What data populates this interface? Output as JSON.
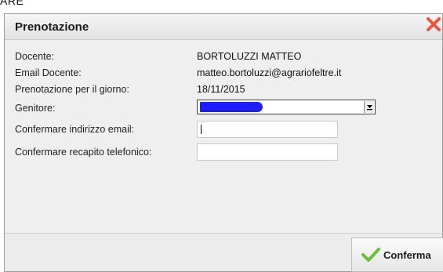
{
  "top_fragment": "ARE",
  "dialog": {
    "title": "Prenotazione",
    "fields": {
      "docente_label": "Docente:",
      "docente_value": "BORTOLUZZI MATTEO",
      "email_label": "Email Docente:",
      "email_value": "matteo.bortoluzzi@agrariofeltre.it",
      "giorno_label": "Prenotazione per il giorno:",
      "giorno_value": "18/11/2015",
      "genitore_label": "Genitore:",
      "conferma_email_label": "Confermare indirizzo email:",
      "conferma_email_value": "",
      "conferma_telefono_label": "Confermare recapito telefonico:",
      "conferma_telefono_value": ""
    },
    "confirm_label": "Conferma"
  },
  "colors": {
    "close_icon": "#e8573f",
    "check_icon": "#6cbf3a",
    "redaction": "#1d1dff"
  },
  "icons": {
    "close": "close-icon",
    "confirm": "check-icon",
    "dropdown": "chevron-down-icon"
  }
}
